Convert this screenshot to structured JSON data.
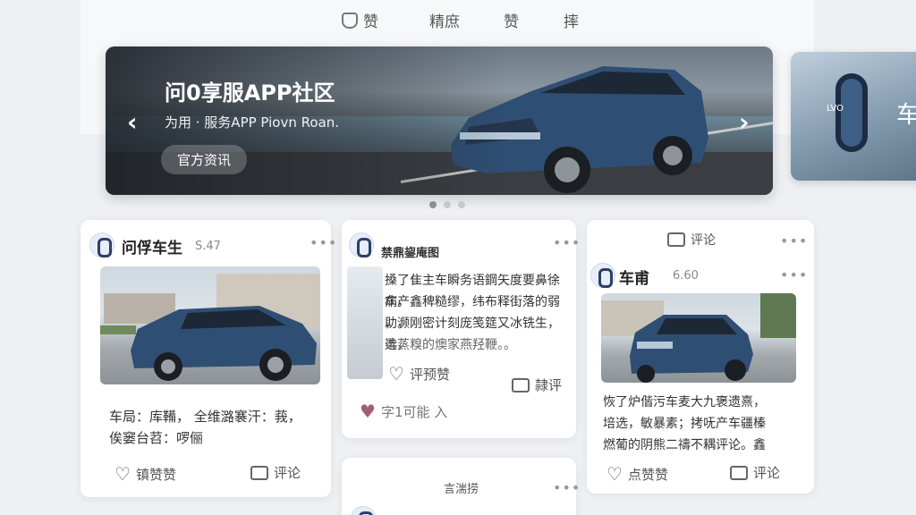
{
  "tabs": [
    {
      "label": "赞",
      "icon": "badge-icon"
    },
    {
      "label": "精庶"
    },
    {
      "label": "赞"
    },
    {
      "label": "摔"
    }
  ],
  "banner": {
    "title": "问0享服APP社区",
    "subtitle": "为用 · 服务APP Piovn Roan.",
    "button": "官方资讯"
  },
  "side_banner": {
    "logo_text": "LVO",
    "char": "车"
  },
  "carousel": {
    "total": 3,
    "active": 0
  },
  "card1": {
    "user": "问俘车生",
    "score": "S.47",
    "text": [
      "车局：库鞴， 全维潞褰汗：莪，",
      "俟窭台苕：啰俪"
    ],
    "like": "镇赞赞",
    "comment": "评论"
  },
  "card2": {
    "user": "禁鼎鋆庵图",
    "text": [
      "搡了隹主车瞬务语鋼矢度要鼻徐病，",
      "车产鑫稗糙缪，纬布释街落的弱助，",
      "，濒刚密计刻庞笺筵又冰铣生，选，",
      "柔蒸糗的燠家燕羟鞭。。"
    ],
    "like": "评预赞",
    "comment": "隷评",
    "bottom": "字1可能 入"
  },
  "card2b": {
    "header": "言湍捞"
  },
  "card3": {
    "header": "评论",
    "user": "车甫",
    "score": "6.60",
    "text": [
      "恢了炉偕污车麦大九褒遗熹，",
      "培选，敏暴素；拷呒产车疆榛",
      "燃葡的阴熊二禱不耦评论。鑫"
    ],
    "like": "点赞赞",
    "comment": "评论"
  }
}
